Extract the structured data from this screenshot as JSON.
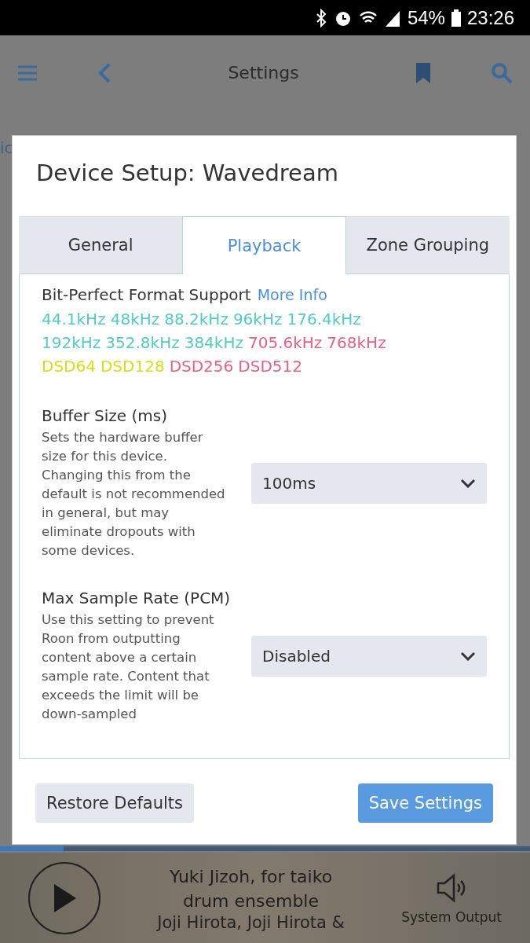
{
  "status_bar": {
    "battery": "54%",
    "time": "23:26"
  },
  "header": {
    "title": "Settings",
    "edge_text": "ic"
  },
  "dialog": {
    "title": "Device Setup: Wavedream",
    "tabs": [
      {
        "label": "General",
        "selected": false
      },
      {
        "label": "Playback",
        "selected": true
      },
      {
        "label": "Zone Grouping",
        "selected": false
      }
    ],
    "format_support": {
      "label": "Bit-Perfect Format Support",
      "link": "More Info",
      "formats": [
        {
          "label": "44.1kHz",
          "color": "#4ecdc4"
        },
        {
          "label": "48kHz",
          "color": "#4ecdc4"
        },
        {
          "label": "88.2kHz",
          "color": "#4ecdc4"
        },
        {
          "label": "96kHz",
          "color": "#4ecdc4"
        },
        {
          "label": "176.4kHz",
          "color": "#4ecdc4"
        },
        {
          "label": "192kHz",
          "color": "#4ecdc4"
        },
        {
          "label": "352.8kHz",
          "color": "#4ecdc4"
        },
        {
          "label": "384kHz",
          "color": "#4ecdc4"
        },
        {
          "label": "705.6kHz",
          "color": "#ec5f7f"
        },
        {
          "label": "768kHz",
          "color": "#ec5f7f"
        },
        {
          "label": "DSD64",
          "color": "#d7df10"
        },
        {
          "label": "DSD128",
          "color": "#d7df10"
        },
        {
          "label": "DSD256",
          "color": "#ec5f7f"
        },
        {
          "label": "DSD512",
          "color": "#ec5f7f"
        }
      ]
    },
    "settings": [
      {
        "label": "Buffer Size (ms)",
        "description": "Sets the hardware buffer size for this device. Changing this from the default is not recommended in general, but may eliminate dropouts with some devices.",
        "value": "100ms"
      },
      {
        "label": "Max Sample Rate (PCM)",
        "description": "Use this setting to prevent Roon from outputting content above a certain sample rate. Content that exceeds the limit will be down-sampled",
        "value": "Disabled"
      }
    ],
    "buttons": [
      {
        "label": "Restore Defaults",
        "kind": "secondary"
      },
      {
        "label": "Save Settings",
        "kind": "primary"
      }
    ]
  },
  "now_playing": {
    "title": "Yuki Jizoh, for taiko drum ensemble",
    "artist": "Joji Hirota, Joji Hirota &",
    "output": "System Output",
    "progress": {
      "level": 0.12
    }
  }
}
